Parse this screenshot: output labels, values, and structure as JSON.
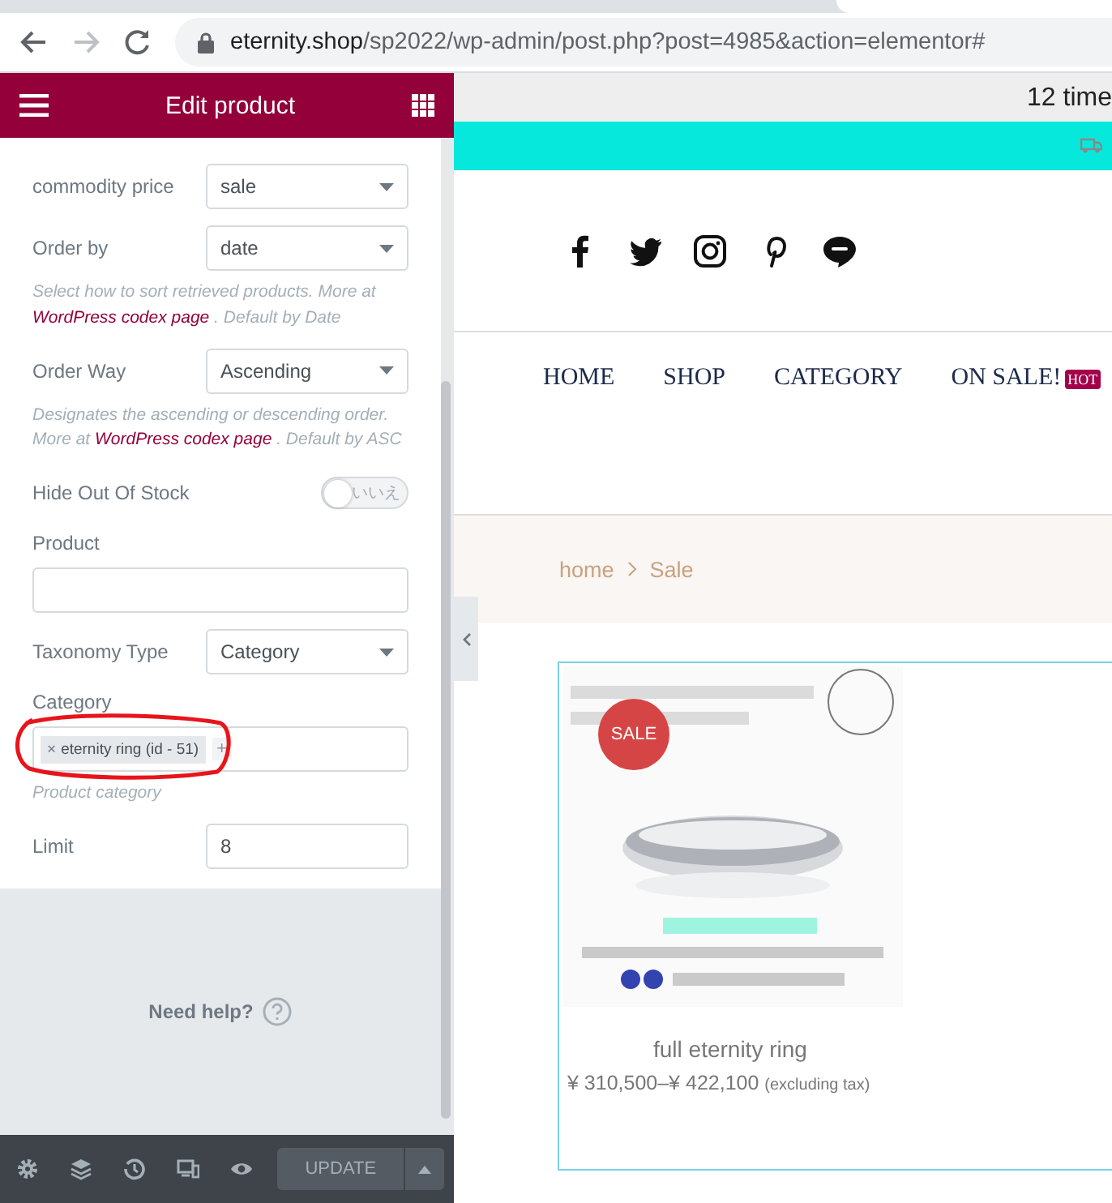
{
  "browser": {
    "url_host": "eternity.shop",
    "url_path": "/sp2022/wp-admin/post.php?post=4985&action=elementor#"
  },
  "panel": {
    "title": "Edit product",
    "controls": [
      {
        "kind": "select",
        "label": "commodity price",
        "value": "sale"
      },
      {
        "kind": "select",
        "label": "Order by",
        "value": "date"
      },
      {
        "kind": "description",
        "before": "Select how to sort retrieved products. More at ",
        "link": "WordPress codex page",
        "after": " . Default by Date"
      },
      {
        "kind": "select",
        "label": "Order Way",
        "value": "Ascending"
      },
      {
        "kind": "description",
        "before": "Designates the ascending or descending order. More at ",
        "link": "WordPress codex page",
        "after": " . Default by ASC"
      },
      {
        "kind": "toggle",
        "label": "Hide Out Of Stock",
        "on": false,
        "state_text": "いいえ"
      },
      {
        "kind": "text",
        "label": "Product"
      },
      {
        "kind": "select",
        "label": "Taxonomy Type",
        "value": "Category"
      },
      {
        "kind": "tags",
        "label": "Category",
        "tags": [
          {
            "remove": "×",
            "text": "eternity ring (id - 51)"
          }
        ],
        "add": "+"
      },
      {
        "kind": "description",
        "before": "Product category"
      },
      {
        "kind": "number",
        "label": "Limit",
        "value": "8"
      }
    ],
    "help": "Need help?",
    "update": "UPDATE"
  },
  "site": {
    "top_text": "12 time",
    "nav": [
      {
        "label": "HOME"
      },
      {
        "label": "SHOP"
      },
      {
        "label": "CATEGORY"
      },
      {
        "label": "ON SALE!",
        "badge": "HOT"
      }
    ],
    "breadcrumb": [
      {
        "label": "home"
      },
      {
        "label": "Sale"
      }
    ],
    "product": {
      "badge": "SALE",
      "name": "full eternity ring",
      "price": "¥ 310,500–¥ 422,100",
      "tax": "(excluding tax)"
    }
  }
}
